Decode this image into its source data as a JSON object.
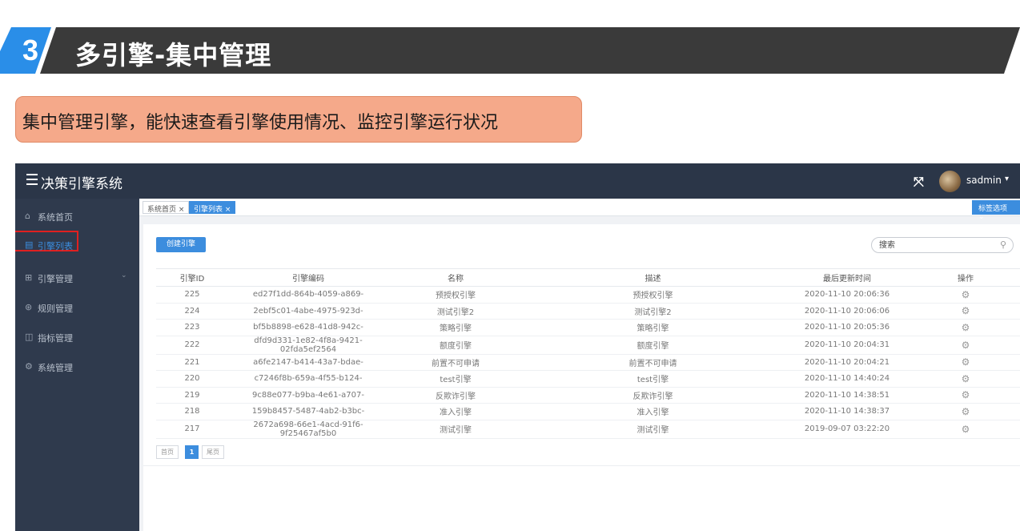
{
  "slide": {
    "section_number": "3",
    "title": "多引擎-集中管理",
    "callout": "集中管理引擎，能快速查看引擎使用情况、监控引擎运行状况"
  },
  "app": {
    "title": "决策引擎系统",
    "username": "sadmin",
    "colors": {
      "topbar": "#2b3648",
      "sidebar": "#2f3a4d",
      "accent": "#3c8dde",
      "highlight": "#e02020"
    }
  },
  "sidebar": {
    "items": [
      {
        "icon": "home-icon",
        "glyph": "⌂",
        "label": "系统首页"
      },
      {
        "icon": "list-icon",
        "glyph": "▤",
        "label": "引擎列表"
      },
      {
        "icon": "grid-icon",
        "glyph": "⊞",
        "label": "引擎管理"
      },
      {
        "icon": "rules-icon",
        "glyph": "⊛",
        "label": "规则管理"
      },
      {
        "icon": "metrics-icon",
        "glyph": "◫",
        "label": "指标管理"
      },
      {
        "icon": "settings-icon",
        "glyph": "⚙",
        "label": "系统管理"
      }
    ]
  },
  "tabs": {
    "items": [
      {
        "label": "系统首页 ×"
      },
      {
        "label": "引擎列表 ×"
      }
    ],
    "options_label": "标签选项 ⌄"
  },
  "toolbar": {
    "create_label": "创建引擎",
    "search_placeholder": "搜索"
  },
  "table": {
    "headers": [
      "引擎ID",
      "引擎编码",
      "名称",
      "描述",
      "最后更新时间",
      "操作"
    ],
    "rows": [
      [
        "225",
        "ed27f1dd-864b-4059-a869-",
        "预授权引擎",
        "预授权引擎",
        "2020-11-10 20:06:36"
      ],
      [
        "224",
        "2ebf5c01-4abe-4975-923d-",
        "测试引擎2",
        "测试引擎2",
        "2020-11-10 20:06:06"
      ],
      [
        "223",
        "bf5b8898-e628-41d8-942c-",
        "策略引擎",
        "策略引擎",
        "2020-11-10 20:05:36"
      ],
      [
        "222",
        "dfd9d331-1e82-4f8a-9421-02fda5ef2564",
        "额度引擎",
        "额度引擎",
        "2020-11-10 20:04:31"
      ],
      [
        "221",
        "a6fe2147-b414-43a7-bdae-",
        "前置不可申请",
        "前置不可申请",
        "2020-11-10 20:04:21"
      ],
      [
        "220",
        "c7246f8b-659a-4f55-b124-",
        "test引擎",
        "test引擎",
        "2020-11-10 14:40:24"
      ],
      [
        "219",
        "9c88e077-b9ba-4e61-a707-",
        "反欺诈引擎",
        "反欺诈引擎",
        "2020-11-10 14:38:51"
      ],
      [
        "218",
        "159b8457-5487-4ab2-b3bc-",
        "准入引擎",
        "准入引擎",
        "2020-11-10 14:38:37"
      ],
      [
        "217",
        "2672a698-66e1-4acd-91f6-9f25467af5b0",
        "测试引擎",
        "测试引擎",
        "2019-09-07 03:22:20"
      ]
    ],
    "action_icon": "gear-icon"
  },
  "pagination": {
    "first_label": "首页",
    "current_page": "1",
    "last_label": "尾页"
  }
}
